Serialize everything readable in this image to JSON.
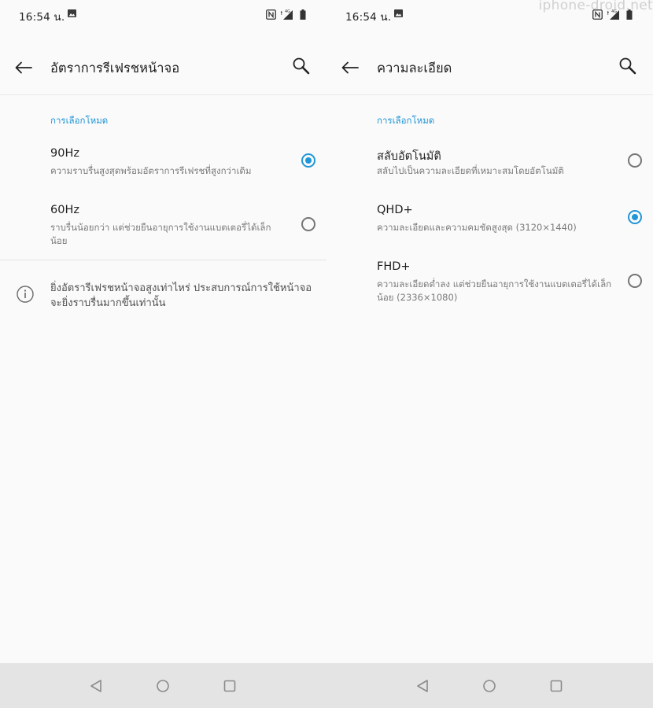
{
  "watermark": "iphone-droid.net",
  "colors": {
    "accent": "#2196d6",
    "text_primary": "#1f1f1f",
    "text_secondary": "#7a7a7a",
    "nav_bar": "#e4e4e4",
    "background": "#fafafa"
  },
  "left": {
    "status": {
      "time": "16:54 น.",
      "icons": [
        "image-icon",
        "nfc-icon",
        "4g-signal-icon",
        "battery-icon"
      ]
    },
    "app_bar": {
      "title": "อัตราการรีเฟรชหน้าจอ",
      "back_icon": "arrow-back-icon",
      "search_icon": "search-icon"
    },
    "section_header": "การเลือกโหมด",
    "options": [
      {
        "title": "90Hz",
        "desc": "ความราบรื่นสูงสุดพร้อมอัตราการรีเฟรชที่สูงกว่าเดิม",
        "selected": true
      },
      {
        "title": "60Hz",
        "desc": "ราบรื่นน้อยกว่า แต่ช่วยยืนอายุการใช้งานแบตเตอรี่ได้เล็กน้อย",
        "selected": false
      }
    ],
    "info": {
      "icon": "info-icon",
      "text": "ยิ่งอัตรารีเฟรชหน้าจอสูงเท่าไหร่ ประสบการณ์การใช้หน้าจอจะยิ่งราบรื่นมากขึ้นเท่านั้น"
    }
  },
  "right": {
    "status": {
      "time": "16:54 น.",
      "icons": [
        "image-icon",
        "nfc-icon",
        "4g-signal-icon",
        "battery-icon"
      ]
    },
    "app_bar": {
      "title": "ความละเอียด",
      "back_icon": "arrow-back-icon",
      "search_icon": "search-icon"
    },
    "section_header": "การเลือกโหมด",
    "options": [
      {
        "title": "สลับอัตโนมัติ",
        "desc": "สลับไปเป็นความละเอียดที่เหมาะสมโดยอัตโนมัติ",
        "selected": false
      },
      {
        "title": "QHD+",
        "desc": "ความละเอียดและความคมชัดสูงสุด (3120×1440)",
        "selected": true
      },
      {
        "title": "FHD+",
        "desc": "ความละเอียดต่ำลง แต่ช่วยยืนอายุการใช้งานแบตเตอรี่ได้เล็กน้อย (2336×1080)",
        "selected": false
      }
    ]
  },
  "nav_bar": {
    "icons": [
      "nav-back-icon",
      "nav-home-icon",
      "nav-recents-icon"
    ]
  }
}
